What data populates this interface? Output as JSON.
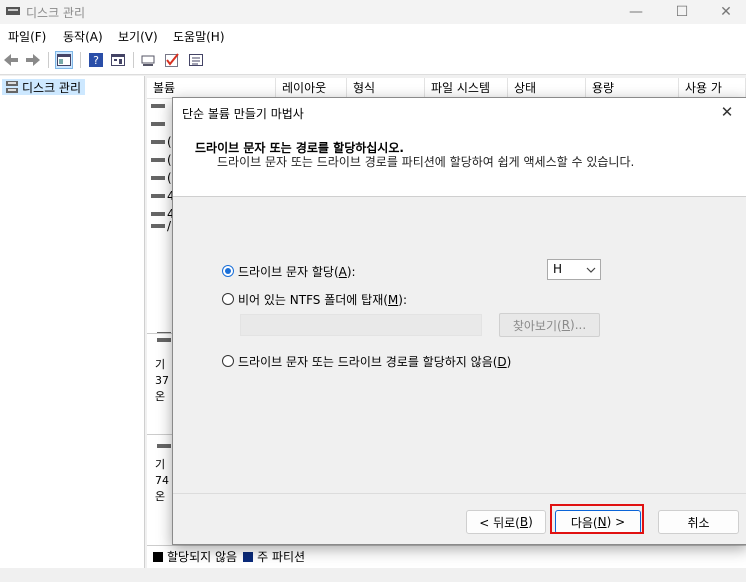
{
  "window": {
    "title": "디스크 관리",
    "controls": {
      "minimize": "—",
      "maximize": "☐",
      "close": "✕"
    }
  },
  "menu": [
    "파일(F)",
    "동작(A)",
    "보기(V)",
    "도움말(H)"
  ],
  "tree": {
    "item": "디스크 관리"
  },
  "columns": [
    "볼륨",
    "레이아웃",
    "형식",
    "파일 시스템",
    "상태",
    "용량",
    "사용 가"
  ],
  "volume_row_marks": [
    "",
    "",
    "(",
    "(",
    "(",
    "4",
    "4",
    "/"
  ],
  "disks": [
    {
      "l1": "기",
      "l2": "37",
      "l3": "온"
    },
    {
      "l1": "기",
      "l2": "74",
      "l3": "온"
    }
  ],
  "legend": {
    "unallocated": "할당되지 않음",
    "primary": "주 파티션"
  },
  "dialog": {
    "title": "단순 볼륨 만들기 마법사",
    "heading": "드라이브 문자 또는 경로를 할당하십시오.",
    "subtitle": "드라이브 문자 또는 드라이브 경로를 파티션에 할당하여 쉽게 액세스할 수 있습니다.",
    "option_assign_pre": "드라이브 문자 할당(",
    "option_assign_key": "A",
    "option_assign_post": "):",
    "option_mount_pre": "비어 있는 NTFS 폴더에 탑재(",
    "option_mount_key": "M",
    "option_mount_post": "):",
    "option_none_pre": "드라이브 문자 또는 드라이브 경로를 할당하지 않음(",
    "option_none_key": "D",
    "option_none_post": ")",
    "selected_drive": "H",
    "browse_pre": "찾아보기(",
    "browse_key": "R",
    "browse_post": ")...",
    "back_pre": "< 뒤로(",
    "back_key": "B",
    "back_post": ")",
    "next_pre": "다음(",
    "next_key": "N",
    "next_post": ") >",
    "cancel": "취소"
  },
  "colors": {
    "accent": "#1a6fd8",
    "highlight": "#e01010",
    "primary_partition": "#0a2a7a",
    "unallocated": "#000000"
  }
}
